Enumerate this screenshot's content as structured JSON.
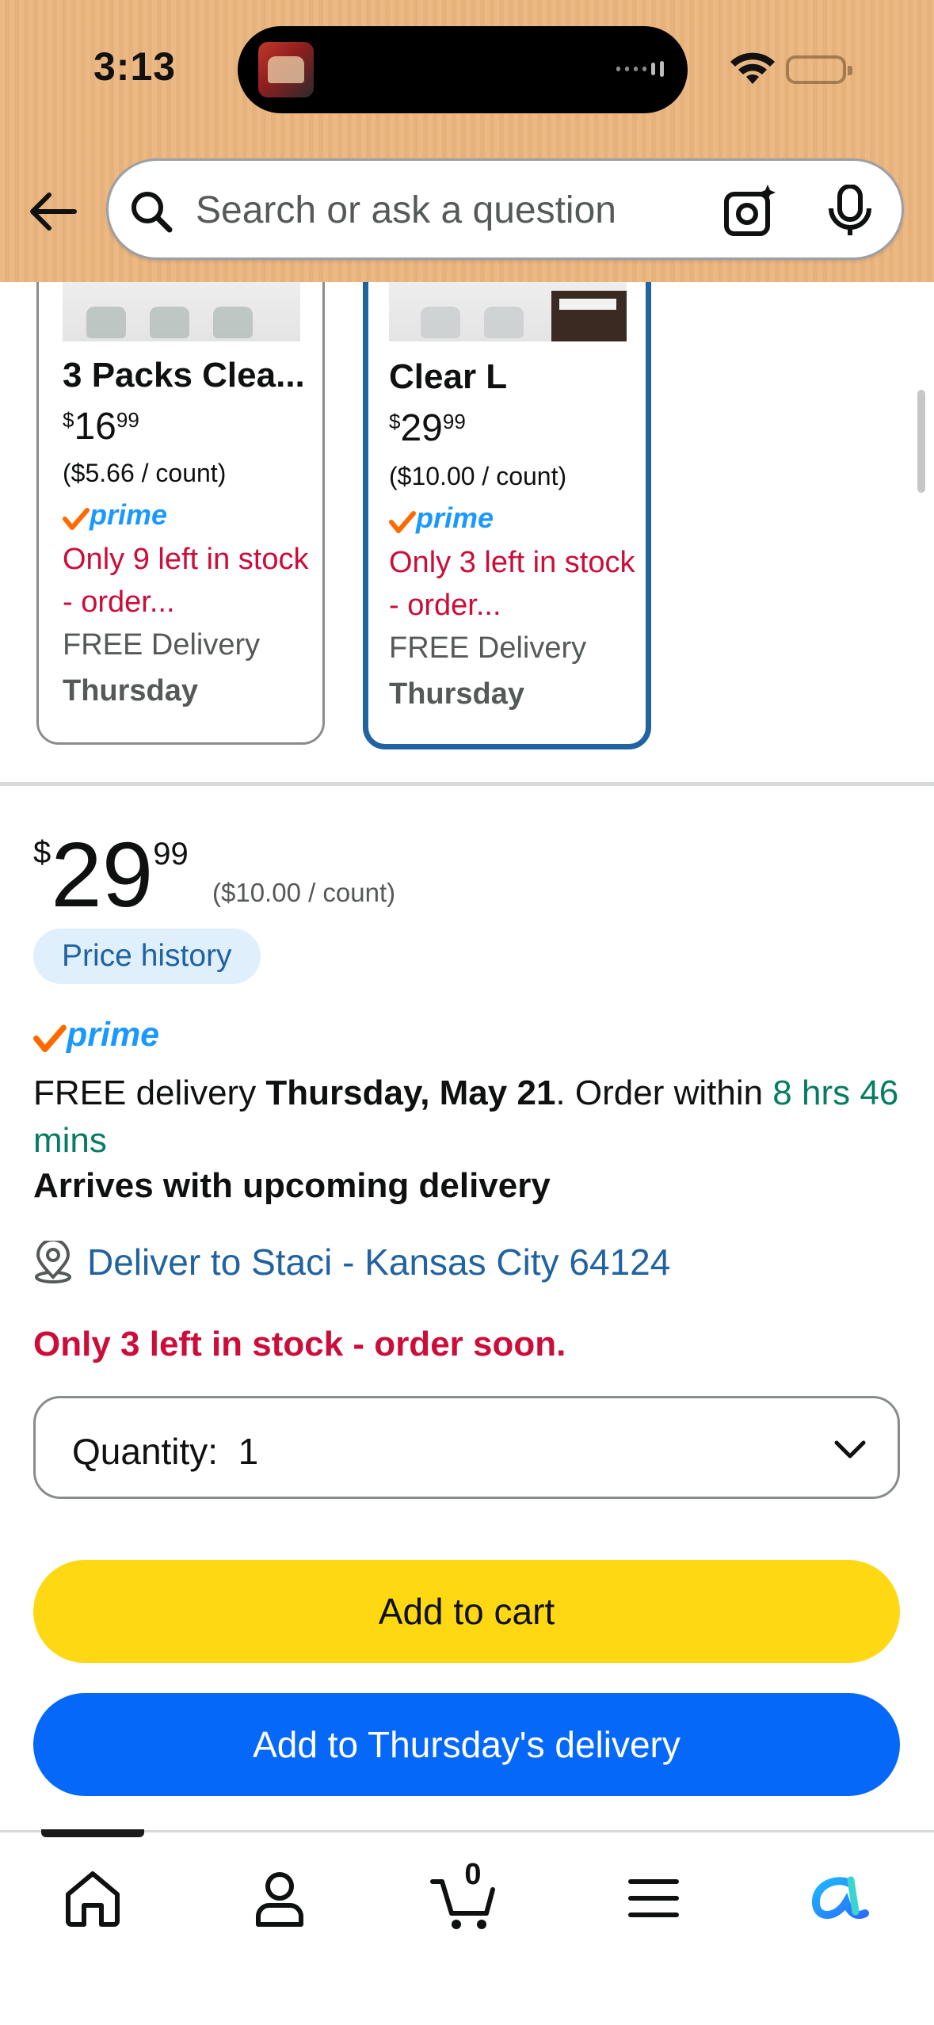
{
  "status_bar": {
    "time": "3:13"
  },
  "search": {
    "placeholder": "Search or ask a question"
  },
  "comparison_cards": [
    {
      "title": "3 Packs Clea...",
      "price_symbol": "$",
      "price_whole": "16",
      "price_fraction": "99",
      "unit_price": "($5.66 / count)",
      "prime": "prime",
      "stock": "Only 9 left in stock - order...",
      "delivery": "FREE Delivery",
      "delivery_day": "Thursday",
      "selected": false
    },
    {
      "title": "Clear L",
      "price_symbol": "$",
      "price_whole": "29",
      "price_fraction": "99",
      "unit_price": "($10.00 / count)",
      "prime": "prime",
      "stock": "Only 3 left in stock - order...",
      "delivery": "FREE Delivery",
      "delivery_day": "Thursday",
      "selected": true
    }
  ],
  "buy_box": {
    "price_symbol": "$",
    "price_whole": "29",
    "price_fraction": "99",
    "unit_price": "($10.00 / count)",
    "price_history_label": "Price history",
    "prime": "prime",
    "delivery_prefix": "FREE delivery ",
    "delivery_date": "Thursday, May 21",
    "order_within_prefix": ". Order within ",
    "order_within_time": "8 hrs 46 mins",
    "arrives": "Arrives with upcoming delivery",
    "deliver_to": "Deliver to Staci - Kansas City 64124",
    "stock_warning": "Only 3 left in stock - order soon.",
    "quantity_label": "Quantity:",
    "quantity_value": "1",
    "add_to_cart": "Add to cart",
    "add_to_delivery": "Add to Thursday's delivery"
  },
  "tab_bar": {
    "cart_count": "0",
    "tabs": [
      "home-icon",
      "account-icon",
      "cart-icon",
      "menu-icon",
      "rufus-icon"
    ]
  },
  "colors": {
    "header_bg": "#ebb57e",
    "link_blue": "#2162a1",
    "prime_blue": "#1a98ff",
    "stock_red": "#cc0c39",
    "timer_green": "#067d62",
    "cart_yellow": "#ffd814",
    "delivery_blue": "#0668f9"
  }
}
